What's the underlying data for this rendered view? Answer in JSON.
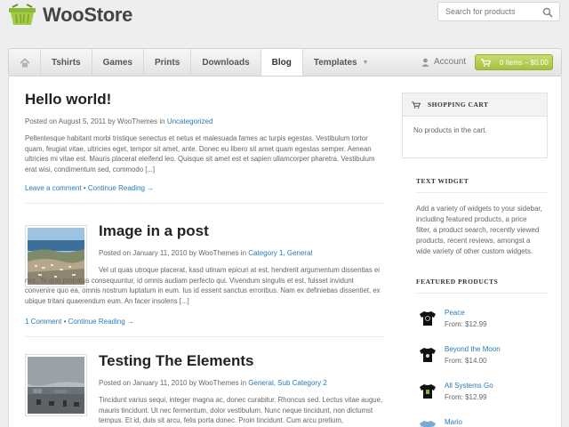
{
  "header": {
    "logo_text": "WooStore",
    "search_placeholder": "Search for products"
  },
  "nav": {
    "items": [
      {
        "label": "Tshirts"
      },
      {
        "label": "Games"
      },
      {
        "label": "Prints"
      },
      {
        "label": "Downloads"
      },
      {
        "label": "Blog"
      },
      {
        "label": "Templates"
      }
    ],
    "active": "Blog",
    "account_label": "Account",
    "cart_label": "0 items – $0.00"
  },
  "posts": [
    {
      "title": "Hello world!",
      "meta_prefix": "Posted on August 5, 2011 by WooThemes in",
      "category": "Uncategorized",
      "excerpt": "Pellentesque habitant morbi tristique senectus et netus et malesuada fames ac turpis egestas. Vestibulum tortor quam, feugiat vitae, ultricies eget, tempor sit amet, ante. Donec eu libero sit amet quam egestas semper. Aenean ultricies mi vitae est. Mauris placerat eleifend leo. Quisque sit amet est et sapien ullamcorper pharetra. Vestibulum erat wisi, condimentum sed, commodo [...]",
      "comments": "Leave a comment",
      "continue": "Continue Reading →"
    },
    {
      "title": "Image in a post",
      "meta_prefix": "Posted on January 11, 2010 by WooThemes in",
      "category": "Category 1, General",
      "excerpt": "Vel ut quas utroque placerat, kasd utinam epicuri at est, hendrerit argumentum dissentias ei nec. Te quo probatus consequuntur, id omnis audiam perfecto qui. Vivendum singulis et est, fuisset invidunt convenire quo ea, omnis nostrum luptatum in eum. Ius id essent sanctus erroribus. Nam ex definiebas dissentiet, ex ubique tritani quaerendum eum. An facer insolens [...]",
      "comments": "1 Comment",
      "continue": "Continue Reading →"
    },
    {
      "title": "Testing The Elements",
      "meta_prefix": "Posted on January 11, 2010 by WooThemes in",
      "category": "General, Sub Category 2",
      "excerpt": "Tincidunt varius sequi, integer magna ac, donec curabitur. Rhoncus sed. Lectus vitae augue, mauris tincidunt. Ut nec fermentum, dolor vestibulum. Nunc neque tincidunt, non dictumst tempus. Et id, duis sit arcu, felis porta donec. Proin tincidunt. Cum arcu pretium,"
    }
  ],
  "sidebar": {
    "cart": {
      "title": "Shopping Cart",
      "empty": "No products in the cart."
    },
    "text_widget": {
      "title": "Text Widget",
      "body": "Add a variety of widgets to your sidebar, including featured products, a price filter, a product search, recently viewed products, recent reviews, amongst a wide variety of other custom widgets."
    },
    "featured": {
      "title": "Featured Products",
      "items": [
        {
          "name": "Peace",
          "price": "From: $12.99"
        },
        {
          "name": "Beyond the Moon",
          "price": "From: $14.00"
        },
        {
          "name": "All Systems Go",
          "price": "From: $12.99"
        },
        {
          "name": "Mario",
          "price": ""
        }
      ]
    }
  },
  "colors": {
    "link": "#2a7ab8",
    "cart_green": "#a7c13f"
  }
}
